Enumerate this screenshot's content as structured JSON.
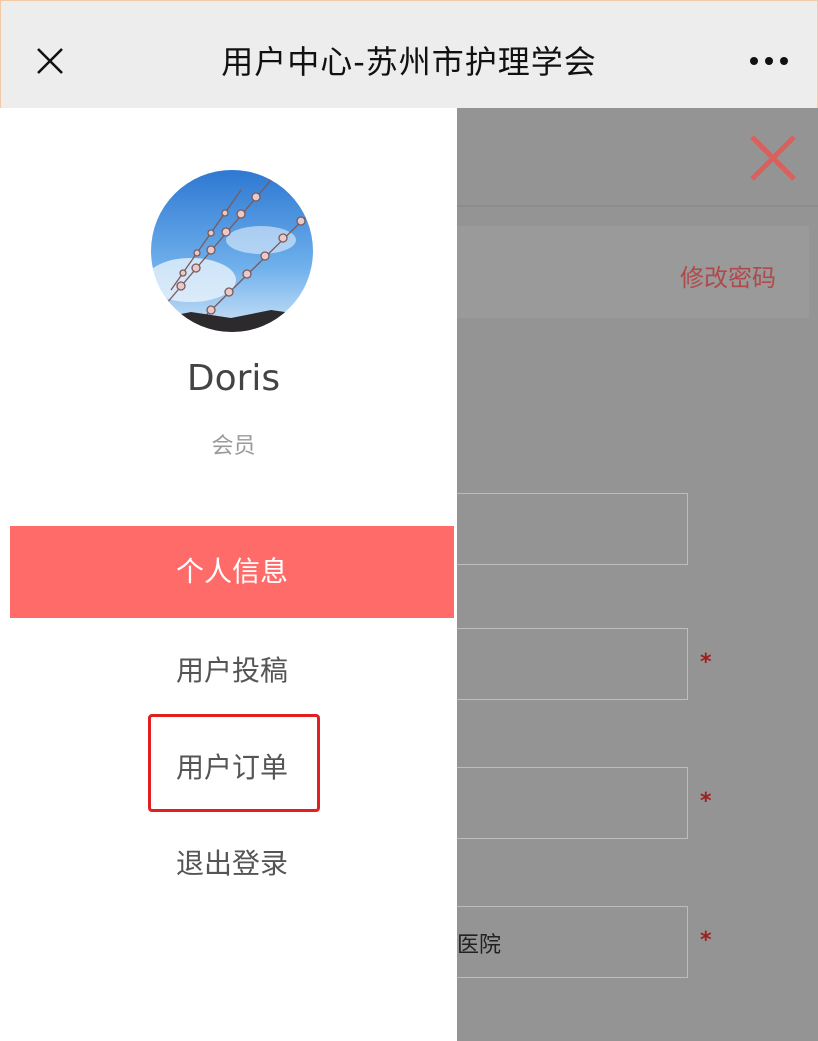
{
  "topbar": {
    "title": "用户中心-苏州市护理学会",
    "close_icon": "close-icon",
    "more_icon": "more-dots-icon"
  },
  "background": {
    "change_password_link": "修改密码",
    "field4_value": "医院",
    "required_mark": "*"
  },
  "profile": {
    "name": "Doris",
    "role": "会员"
  },
  "menu": {
    "items": [
      {
        "label": "个人信息",
        "active": true
      },
      {
        "label": "用户投稿",
        "active": false
      },
      {
        "label": "用户订单",
        "active": false
      },
      {
        "label": "退出登录",
        "active": false
      }
    ]
  },
  "colors": {
    "accent": "#ff6b68",
    "highlight": "#e22020",
    "overlay": "#949494"
  }
}
